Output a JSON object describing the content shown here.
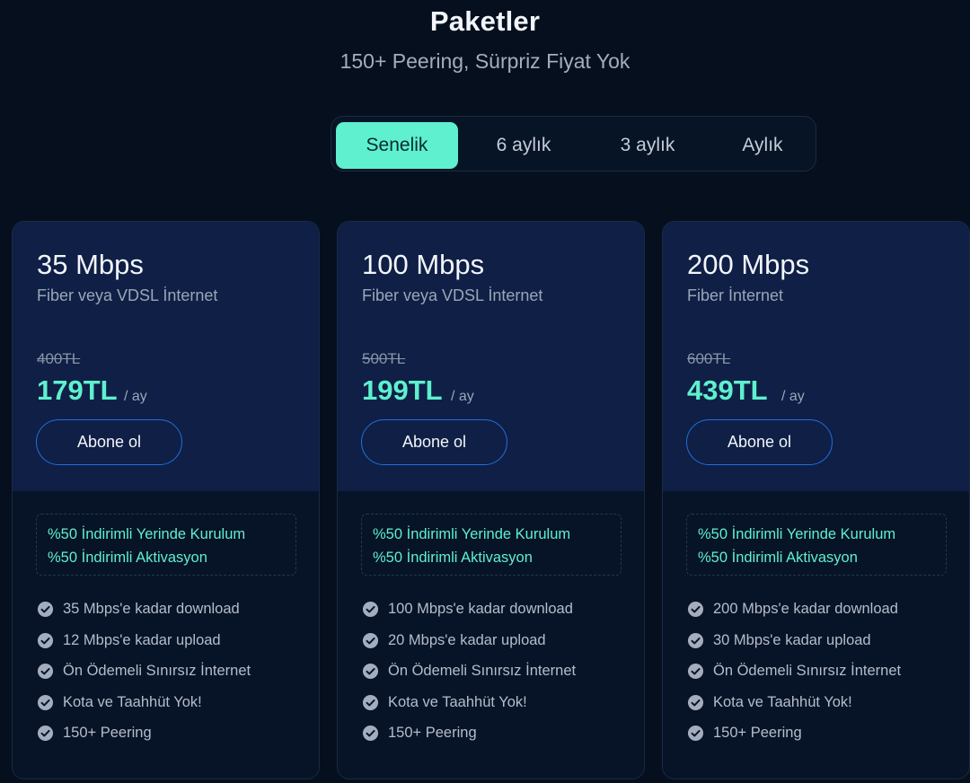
{
  "header": {
    "title": "Paketler",
    "subtitle": "150+ Peering, Sürpriz Fiyat Yok"
  },
  "period_toggle": {
    "options": [
      "Senelik",
      "6 aylık",
      "3 aylık",
      "Aylık"
    ],
    "selected": "Senelik"
  },
  "colors": {
    "background": "#050f1e",
    "card_top": "#0f1f45",
    "accent": "#5ef0cf",
    "button_border": "#1f6fe0"
  },
  "plans": [
    {
      "name": "35 Mbps",
      "type": "Fiber veya VDSL İnternet",
      "old_price": "400TL",
      "price": "179TL",
      "per": "/ ay",
      "button_label": "Abone ol",
      "promos": [
        "%50 İndirimli Yerinde Kurulum",
        "%50 İndirimli Aktivasyon"
      ],
      "features": [
        "35 Mbps'e kadar download",
        "12 Mbps'e kadar upload",
        "Ön Ödemeli Sınırsız İnternet",
        "Kota ve Taahhüt Yok!",
        "150+ Peering"
      ]
    },
    {
      "name": "100 Mbps",
      "type": "Fiber veya VDSL İnternet",
      "old_price": "500TL",
      "price": "199TL",
      "per": "/ ay",
      "button_label": "Abone ol",
      "promos": [
        "%50 İndirimli Yerinde Kurulum",
        "%50 İndirimli Aktivasyon"
      ],
      "features": [
        "100 Mbps'e kadar download",
        "20 Mbps'e kadar upload",
        "Ön Ödemeli Sınırsız İnternet",
        "Kota ve Taahhüt Yok!",
        "150+ Peering"
      ]
    },
    {
      "name": "200 Mbps",
      "type": "Fiber İnternet",
      "old_price": "600TL",
      "price": "439TL",
      "per": "/ ay",
      "button_label": "Abone ol",
      "promos": [
        "%50 İndirimli Yerinde Kurulum",
        "%50 İndirimli Aktivasyon"
      ],
      "features": [
        "200 Mbps'e kadar download",
        "30 Mbps'e kadar upload",
        "Ön Ödemeli Sınırsız İnternet",
        "Kota ve Taahhüt Yok!",
        "150+ Peering"
      ]
    }
  ],
  "icons": {
    "feature": "check-circle-icon"
  }
}
